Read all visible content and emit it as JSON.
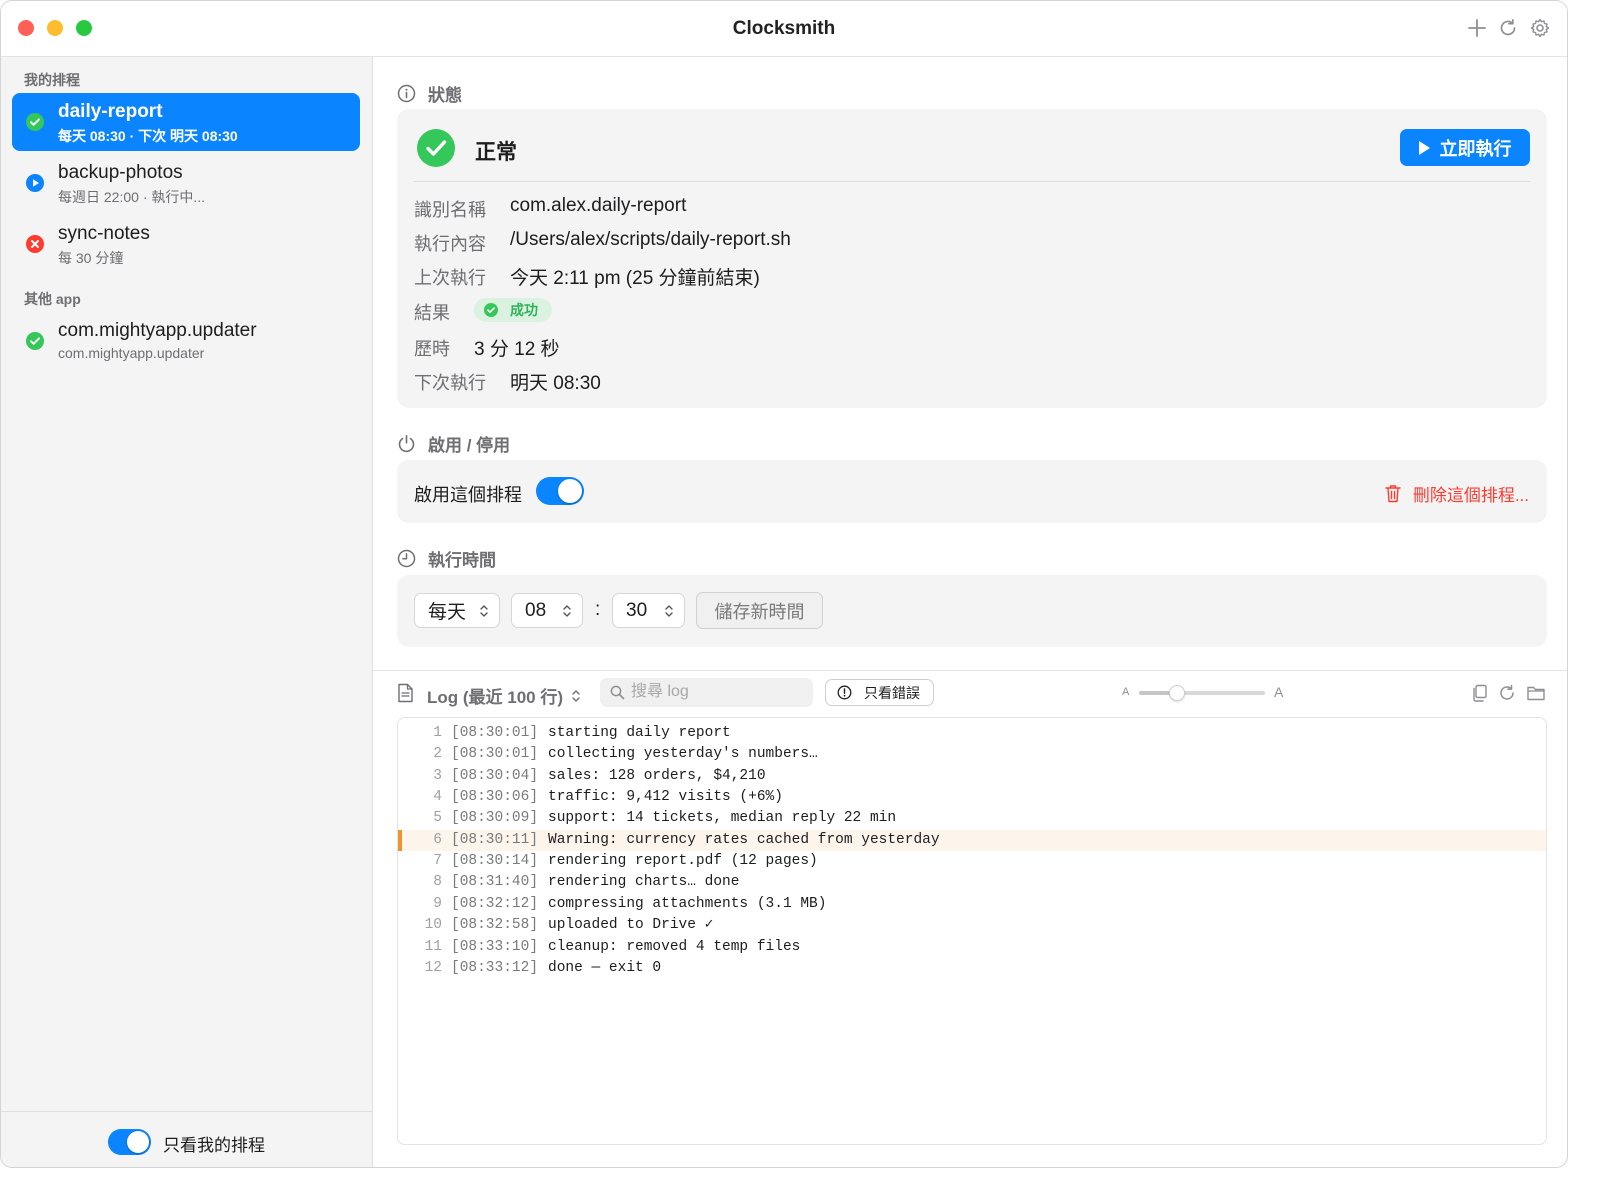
{
  "window": {
    "title": "Clocksmith"
  },
  "sidebar": {
    "sections": [
      {
        "label": "我的排程",
        "items": [
          {
            "name": "daily-report",
            "sub": "每天 08:30 · 下次 明天 08:30",
            "status": "ok",
            "selected": true
          },
          {
            "name": "backup-photos",
            "sub": "每週日 22:00 · 執行中...",
            "status": "running",
            "selected": false
          },
          {
            "name": "sync-notes",
            "sub": "每 30 分鐘",
            "status": "error",
            "selected": false
          }
        ]
      },
      {
        "label": "其他 app",
        "items": [
          {
            "name": "com.mightyapp.updater",
            "sub": "com.mightyapp.updater",
            "status": "ok",
            "selected": false
          }
        ]
      }
    ],
    "footer": {
      "toggle_on": true,
      "label": "只看我的排程"
    }
  },
  "status_section": {
    "heading": "狀態",
    "status": "正常",
    "run_now": "立即執行",
    "fields": {
      "id_label": "識別名稱",
      "id_value": "com.alex.daily-report",
      "cmd_label": "執行內容",
      "cmd_value": "/Users/alex/scripts/daily-report.sh",
      "last_label": "上次執行",
      "last_value": "今天 2:11 pm (25 分鐘前結束)",
      "result_label": "結果",
      "result_value": "成功",
      "duration_label": "歷時",
      "duration_value": "3 分 12 秒",
      "next_label": "下次執行",
      "next_value": "明天 08:30"
    }
  },
  "enable_section": {
    "heading": "啟用 / 停用",
    "toggle_label": "啟用這個排程",
    "toggle_on": true,
    "delete_label": "刪除這個排程..."
  },
  "time_section": {
    "heading": "執行時間",
    "frequency": "每天",
    "hour": "08",
    "colon": ":",
    "minute": "30",
    "save_label": "儲存新時間"
  },
  "log": {
    "title": "Log (最近 100 行)",
    "search_placeholder": "搜尋 log",
    "errors_only_label": "只看錯誤",
    "font_small": "A",
    "font_large": "A",
    "font_size_level": 0.27,
    "lines": [
      {
        "n": "1",
        "ts": "[08:30:01]",
        "msg": "starting daily report",
        "level": "info"
      },
      {
        "n": "2",
        "ts": "[08:30:01]",
        "msg": "collecting yesterday's numbers…",
        "level": "info"
      },
      {
        "n": "3",
        "ts": "[08:30:04]",
        "msg": "sales: 128 orders, $4,210",
        "level": "info"
      },
      {
        "n": "4",
        "ts": "[08:30:06]",
        "msg": "traffic: 9,412 visits (+6%)",
        "level": "info"
      },
      {
        "n": "5",
        "ts": "[08:30:09]",
        "msg": "support: 14 tickets, median reply 22 min",
        "level": "info"
      },
      {
        "n": "6",
        "ts": "[08:30:11]",
        "msg": "Warning: currency rates cached from yesterday",
        "level": "warning"
      },
      {
        "n": "7",
        "ts": "[08:30:14]",
        "msg": "rendering report.pdf (12 pages)",
        "level": "info"
      },
      {
        "n": "8",
        "ts": "[08:31:40]",
        "msg": "rendering charts… done",
        "level": "info"
      },
      {
        "n": "9",
        "ts": "[08:32:12]",
        "msg": "compressing attachments (3.1 MB)",
        "level": "info"
      },
      {
        "n": "10",
        "ts": "[08:32:58]",
        "msg": "uploaded to Drive ✓",
        "level": "info"
      },
      {
        "n": "11",
        "ts": "[08:33:10]",
        "msg": "cleanup: removed 4 temp files",
        "level": "info"
      },
      {
        "n": "12",
        "ts": "[08:33:12]",
        "msg": "done — exit 0",
        "level": "info"
      }
    ]
  },
  "colors": {
    "accent": "#0a84ff",
    "success": "#34c759",
    "error": "#ff3b30",
    "warning": "#f0922e",
    "sidebar_bg": "#f4f4f4"
  },
  "icons": {
    "titlebar": [
      "plus-icon",
      "refresh-icon",
      "gear-icon"
    ],
    "log_toolbar": [
      "copy-icon",
      "reload-icon",
      "folder-icon"
    ]
  }
}
